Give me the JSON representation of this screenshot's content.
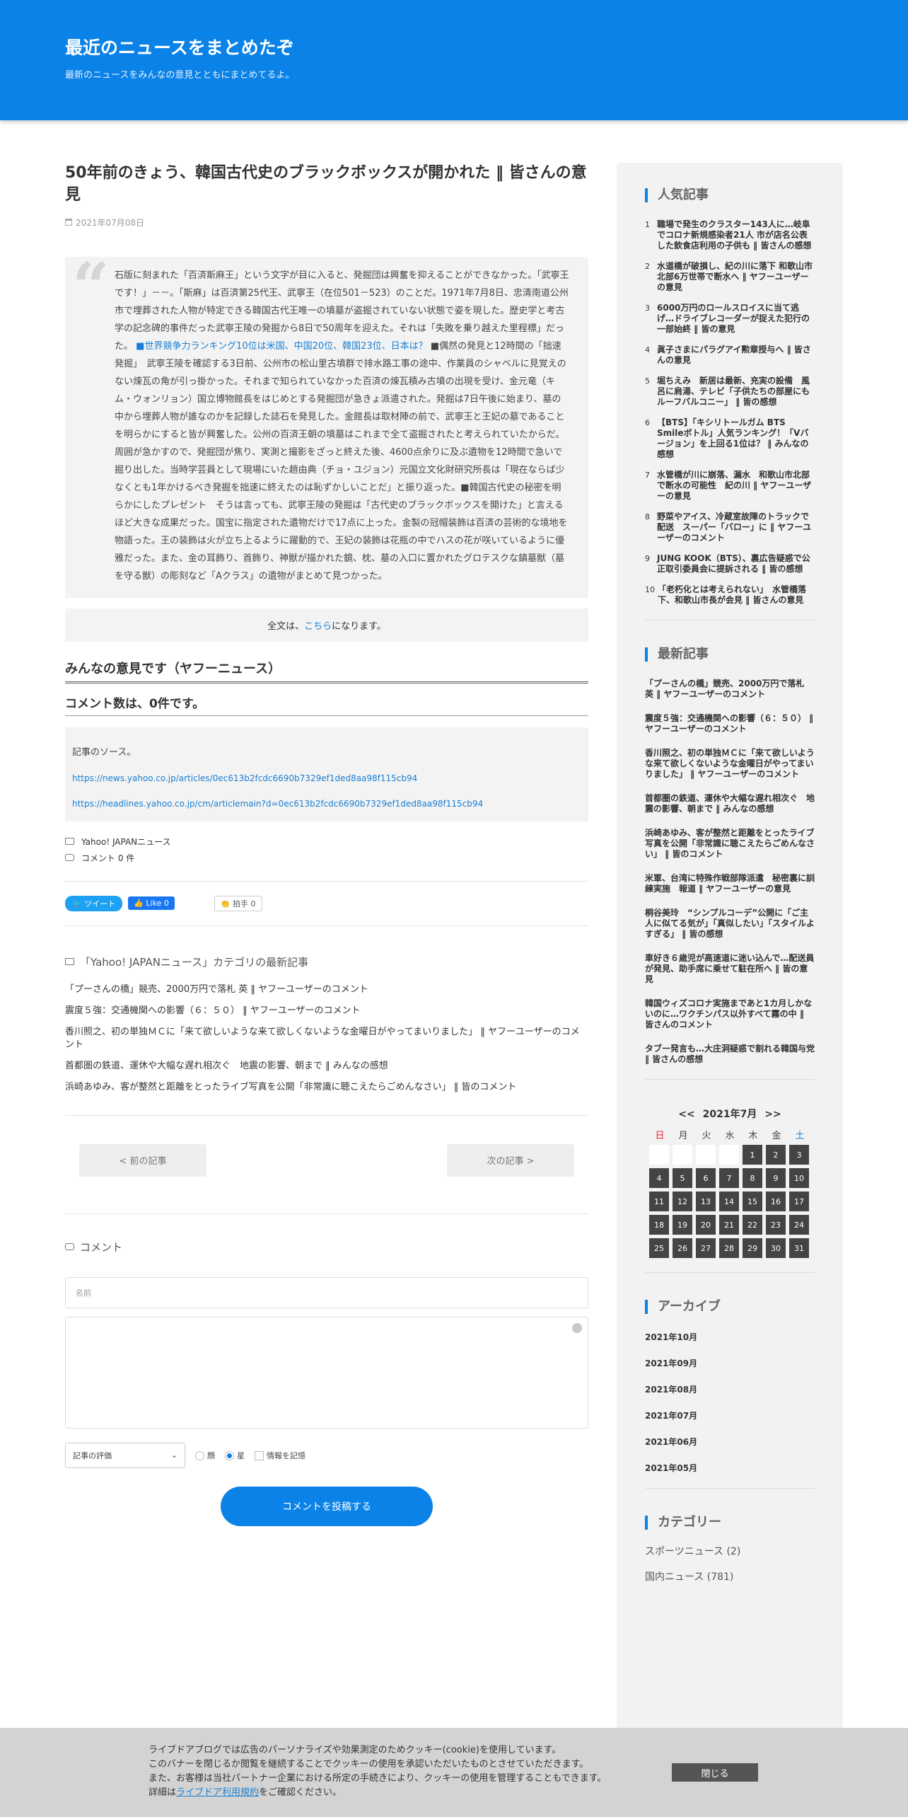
{
  "header": {
    "title": "最近のニュースをまとめたぞ",
    "description": "最新のニュースをみんなの意見とともにまとめてるよ。"
  },
  "post": {
    "title": "50年前のきょう、韓国古代史のブラックボックスが開かれた ‖ 皆さんの意見",
    "date": "2021年07月08日",
    "quote_part1": "石版に刻まれた「百済斯麻王」という文字が目に入ると、発掘団は興奮を抑えることができなかった。「武寧王です！」－－。「斯麻」は百済第25代王、武寧王（在位501－523）のことだ。1971年7月8日、忠清南道公州市で埋葬された人物が特定できる韓国古代王唯一の墳墓が盗掘されていない状態で姿を現した。歴史学と考古学の記念碑的事件だった武寧王陵の発掘から8日で50周年を迎えた。それは「失敗を乗り越えた里程標」だった。",
    "quote_link": "■世界競争力ランキング10位は米国、中国20位、韓国23位、日本は？",
    "quote_part2": "■偶然の発見と12時間の「拙速発掘」　武寧王陵を確認する3日前、公州市の松山里古墳群で排水路工事の途中、作業員のシャベルに見覚えのない煉瓦の角が引っ掛かった。それまで知られていなかった百済の煉瓦積み古墳の出現を受け、金元竜（キム・ウォンリョン）国立博物館長をはじめとする発掘団が急きょ派遣された。発掘は7日午後に始まり、墓の中から埋葬人物が誰なのかを記録した誌石を発見した。金館長は取材陣の前で、武寧王と王妃の墓であることを明らかにすると皆が興奮した。公州の百済王朝の墳墓はこれまで全て盗掘されたと考えられていたからだ。　周囲が急かすので、発掘団が焦り、実測と撮影をざっと終えた後、4600点余りに及ぶ遺物を12時間で急いで掘り出した。当時学芸員として現場にいた趙由典（チョ・ユジョン）元国立文化財研究所長は「現在ならば少なくとも1年かけるべき発掘を拙速に終えたのは恥ずかしいことだ」と振り返った。■韓国古代史の秘密を明らかにしたプレゼント　そうは言っても、武寧王陵の発掘は「古代史のブラックボックスを開けた」と言えるほど大きな成果だった。国宝に指定された遺物だけで17点に上った。金製の冠帽装飾は百済の芸術的な境地を物語った。王の装飾は火が立ち上るように躍動的で、王妃の装飾は花瓶の中でハスの花が咲いているように優雅だった。また、金の耳飾り、首飾り、神獣が描かれた鏡、枕、墓の入口に置かれたグロテスクな鎮墓獣（墓を守る獣）の彫刻など「Aクラス」の遺物がまとめて見つかった。",
    "fulltext_pre": "全文は、",
    "fulltext_link": "こちら",
    "fulltext_post": "になります。",
    "opinion_heading": "みんなの意見です（ヤフーニュース）",
    "comment_count_heading": "コメント数は、0件です。",
    "source_label": "記事のソース。",
    "source_url1": "https://news.yahoo.co.jp/articles/0ec613b2fcdc6690b7329ef1ded8aa98f115cb94",
    "source_url2": "https://headlines.yahoo.co.jp/cm/articlemain?d=0ec613b2fcdc6690b7329ef1ded8aa98f115cb94",
    "category": "Yahoo! JAPANニュース",
    "comment_meta": "コメント  0 件"
  },
  "share": {
    "tweet": "ツイート",
    "like": "Like 0",
    "clap": "拍手  0"
  },
  "category_latest": {
    "heading": "「Yahoo! JAPANニュース」カテゴリの最新記事",
    "items": [
      "「プーさんの橋」競売、2000万円で落札 英 ‖ ヤフーユーザーのコメント",
      "震度５強：交通機関への影響（６：５０） ‖ ヤフーユーザーのコメント",
      "香川照之、初の単独ＭＣに「来て欲しいような来て欲しくないような金曜日がやってまいりました」 ‖ ヤフーユーザーのコメント",
      "首都圏の鉄道、運休や大幅な遅れ相次ぐ　地震の影響、朝まで ‖ みんなの感想",
      "浜崎あゆみ、客が整然と距離をとったライブ写真を公開「非常識に聴こえたらごめんなさい」 ‖ 皆のコメント"
    ]
  },
  "pager": {
    "prev": "< 前の記事",
    "next": "次の記事 >"
  },
  "comment_form": {
    "heading": "コメント",
    "name_placeholder": "名前",
    "rating_select": "記事の評価",
    "radio_face": "顔",
    "radio_star": "星",
    "remember": "情報を記憶",
    "submit": "コメントを投稿する"
  },
  "sidebar": {
    "popular_heading": "人気記事",
    "popular": [
      "職場で発生のクラスター143人に…岐阜でコロナ新規感染者21人 市が店名公表した飲食店利用の子供も ‖ 皆さんの感想",
      "水道橋が破損し、紀の川に落下 和歌山市北部6万世帯で断水へ ‖ ヤフーユーザーの意見",
      "6000万円のロールスロイスに当て逃げ…ドライブレコーダーが捉えた犯行の一部始終 ‖ 皆の意見",
      "眞子さまにパラグアイ勲章授与へ ‖ 皆さんの意見",
      "堀ちえみ　新居は最新、充実の設備　風呂に肩湯、テレビ「子供たちの部屋にもルーフバルコニー」 ‖ 皆の感想",
      "【BTS】「キシリトールガム BTS Smileボトル」人気ランキング！「Vバージョン」を上回る1位は？ ‖ みんなの感想",
      "水管橋が川に崩落、漏水　和歌山市北部で断水の可能性　紀の川 ‖ ヤフーユーザーの意見",
      "野菜やアイス、冷蔵室故障のトラックで配送　スーパー「バロー」に ‖ ヤフーユーザーのコメント",
      "JUNG KOOK（BTS）、裏広告疑惑で公正取引委員会に提訴される ‖ 皆の感想",
      "「老朽化とは考えられない」　水管橋落下、和歌山市長が会見 ‖ 皆さんの意見"
    ],
    "recent_heading": "最新記事",
    "recent": [
      "「プーさんの橋」競売、2000万円で落札 英 ‖ ヤフーユーザーのコメント",
      "震度５強：交通機関への影響（６：５０） ‖ ヤフーユーザーのコメント",
      "香川照之、初の単独ＭＣに「来て欲しいような来て欲しくないような金曜日がやってまいりました」 ‖ ヤフーユーザーのコメント",
      "首都圏の鉄道、運休や大幅な遅れ相次ぐ　地震の影響、朝まで ‖ みんなの感想",
      "浜崎あゆみ、客が整然と距離をとったライブ写真を公開「非常識に聴こえたらごめんなさい」 ‖ 皆のコメント",
      "米軍、台湾に特殊作戦部隊派遣　秘密裏に訓練実施　報道 ‖ ヤフーユーザーの意見",
      "桐谷美玲　“シンプルコーデ”公開に「ご主人に似てる気が」「真似したい」「スタイルよすぎる」 ‖ 皆の感想",
      "車好き６歳児が高速道に迷い込んで…配送員が発見、助手席に乗せて駐在所へ ‖ 皆の意見",
      "韓国ウィズコロナ実施まであと1カ月しかないのに…ワクチンパス以外すべて霧の中 ‖ 皆さんのコメント",
      "タブー発言も…大庄洞疑惑で割れる韓国与党 ‖ 皆さんの感想"
    ],
    "calendar": {
      "prev": "<<",
      "title": "2021年7月",
      "next": ">>",
      "dow": [
        "日",
        "月",
        "火",
        "水",
        "木",
        "金",
        "土"
      ],
      "leading_blanks": 4,
      "days": [
        "1",
        "2",
        "3",
        "4",
        "5",
        "6",
        "7",
        "8",
        "9",
        "10",
        "11",
        "12",
        "13",
        "14",
        "15",
        "16",
        "17",
        "18",
        "19",
        "20",
        "21",
        "22",
        "23",
        "24",
        "25",
        "26",
        "27",
        "28",
        "29",
        "30",
        "31"
      ]
    },
    "archive_heading": "アーカイブ",
    "archives": [
      "2021年10月",
      "2021年09月",
      "2021年08月",
      "2021年07月",
      "2021年06月",
      "2021年05月"
    ],
    "category_heading": "カテゴリー",
    "categories": [
      "スポーツニュース (2)",
      "国内ニュース (781)"
    ]
  },
  "cookie": {
    "line1": "ライブドアブログでは広告のパーソナライズや効果測定のためクッキー(cookie)を使用しています。",
    "line2": "このバナーを閉じるか閲覧を継続することでクッキーの使用を承認いただいたものとさせていただきます。",
    "line3": "また、お客様は当社パートナー企業における所定の手続きにより、クッキーの使用を管理することもできます。",
    "line4_pre": "詳細は",
    "line4_link": "ライブドア利用規約",
    "line4_post": "をご確認ください。",
    "close": "閉じる"
  },
  "colors": {
    "accent": "#0a82e8",
    "link": "#1a7fd4",
    "calendar_sunday": "#ee2233",
    "calendar_saturday": "#1a7fd4"
  }
}
